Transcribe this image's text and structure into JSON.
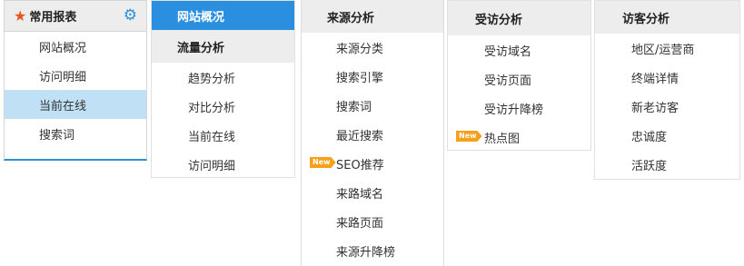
{
  "panel_common": {
    "header": "常用报表",
    "items": [
      "网站概况",
      "访问明细",
      "当前在线",
      "搜索词"
    ],
    "active_index": 2
  },
  "panel_traffic": {
    "top_tab": "网站概况",
    "header": "流量分析",
    "items": [
      "趋势分析",
      "对比分析",
      "当前在线",
      "访问明细"
    ]
  },
  "panel_source": {
    "header": "来源分析",
    "items": [
      "来源分类",
      "搜索引擎",
      "搜索词",
      "最近搜索",
      "SEO推荐",
      "来路域名",
      "来路页面",
      "来源升降榜"
    ],
    "new_item_index": 4
  },
  "panel_visited": {
    "header": "受访分析",
    "items": [
      "受访域名",
      "受访页面",
      "受访升降榜",
      "热点图"
    ],
    "new_item_index": 3
  },
  "panel_visitor": {
    "header": "访客分析",
    "items": [
      "地区/运营商",
      "终端详情",
      "新老访客",
      "忠诚度",
      "活跃度"
    ]
  },
  "badge_text": "New",
  "colors": {
    "accent": "#2b8fe0",
    "active_bg": "#bfe0f5",
    "star": "#e8571e",
    "badge": "#f5a11b"
  }
}
